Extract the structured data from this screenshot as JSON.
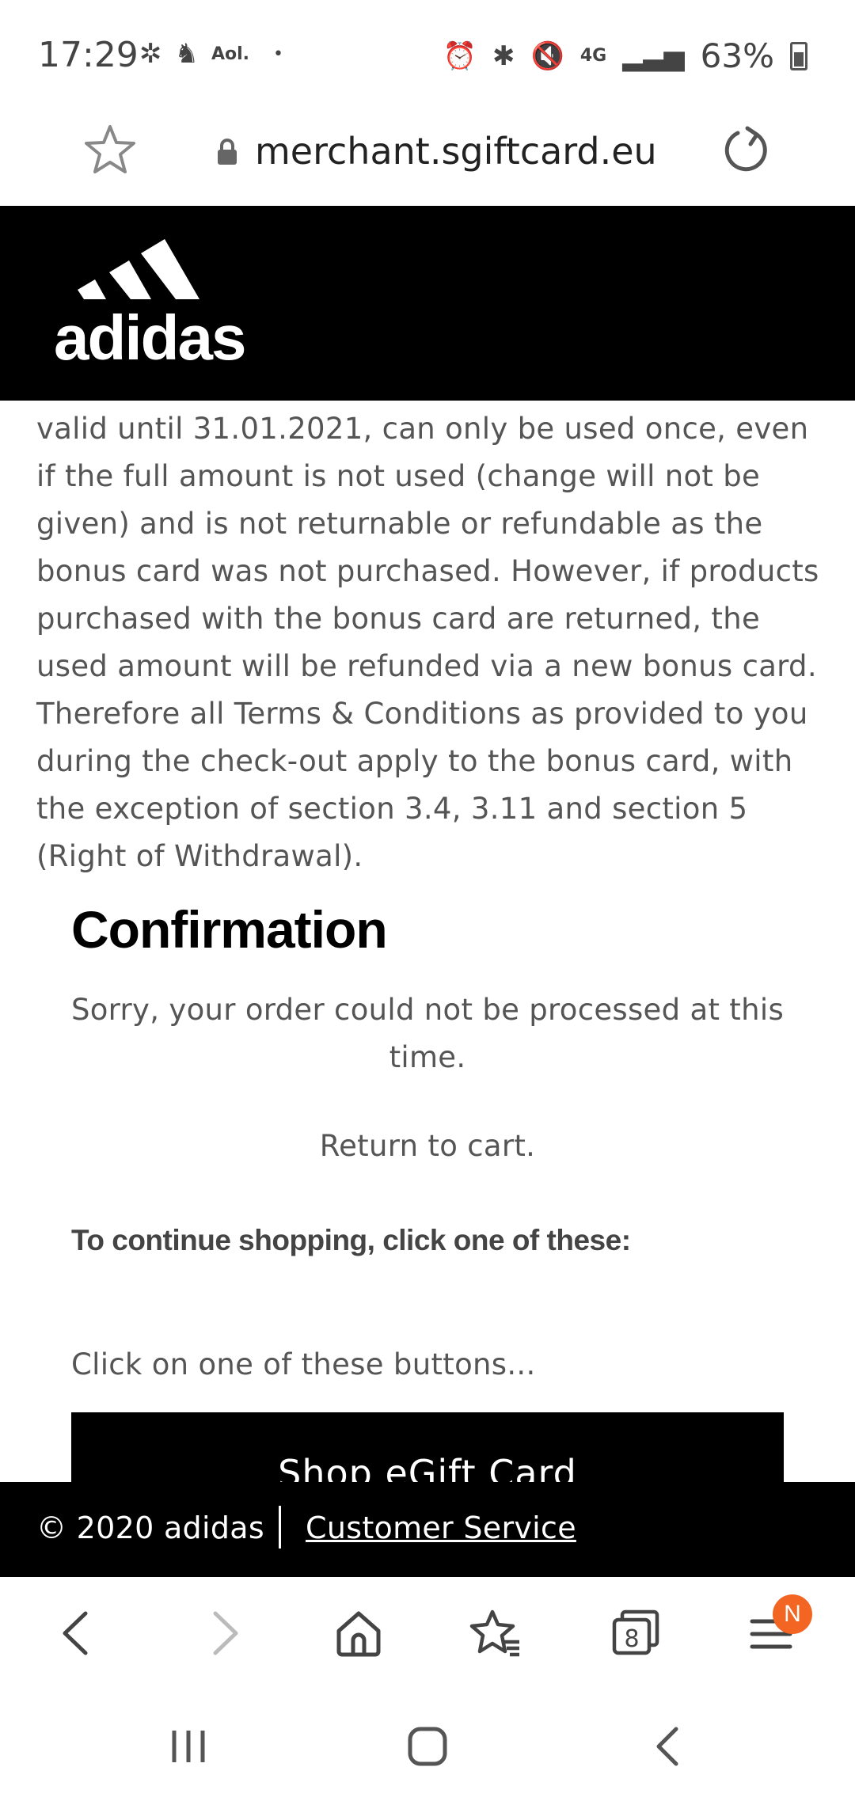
{
  "status_bar": {
    "time": "17:29",
    "aol_label": "Aol.",
    "dot": "•",
    "network": "4G",
    "battery": "63%"
  },
  "address_bar": {
    "url": "merchant.sgiftcard.eu"
  },
  "brand": {
    "name": "adidas"
  },
  "content": {
    "terms_text": "valid until 31.01.2021, can only be used once, even if the full amount is not used (change will not be given) and is not returnable or refundable as the bonus card was not purchased. However, if products purchased with the bonus card are returned, the used amount will be refunded via a new bonus card. Therefore all Terms & Conditions as provided to you during the check-out apply to the bonus card, with the exception of section 3.4, 3.11 and section 5 (Right of Withdrawal).",
    "confirmation_title": "Confirmation",
    "sorry_message": "Sorry, your order could not be processed at this time.",
    "return_link": "Return to cart.",
    "continue_heading": "To continue shopping, click one of these:",
    "click_on_text": "Click on one of these buttons...",
    "shop_button": "Shop eGift Card"
  },
  "footer": {
    "copyright": "© 2020 adidas",
    "customer_service": "Customer Service"
  },
  "browser_toolbar": {
    "tabs_count": "8",
    "menu_badge": "N",
    "badge_color": "#f26522"
  },
  "icons": [
    "star-icon",
    "lock-icon",
    "reload-icon",
    "back-icon",
    "forward-icon",
    "home-icon",
    "bookmarks-icon",
    "tabs-icon",
    "menu-icon",
    "recent-apps-icon",
    "home-circle-icon",
    "system-back-icon"
  ]
}
